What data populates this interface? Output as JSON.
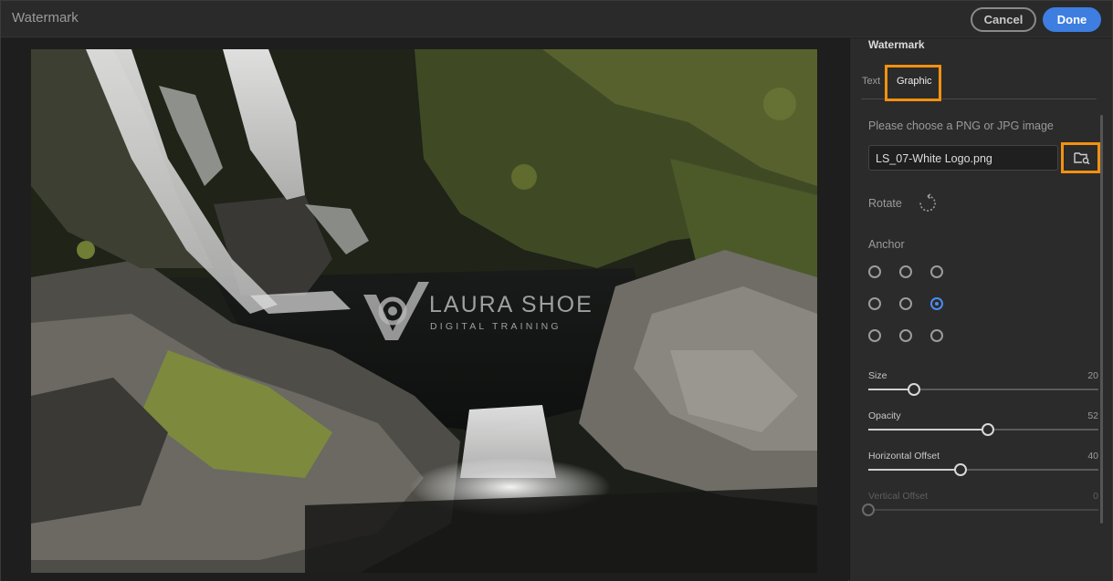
{
  "window": {
    "title": "Watermark"
  },
  "header": {
    "cancel_label": "Cancel",
    "done_label": "Done"
  },
  "preview": {
    "watermark": {
      "name": "LAURA SHOE",
      "subtitle": "DIGITAL TRAINING"
    }
  },
  "panel": {
    "title": "Watermark",
    "tabs": [
      {
        "label": "Text",
        "selected": false
      },
      {
        "label": "Graphic",
        "selected": true
      }
    ],
    "choose_label": "Please choose a PNG or JPG image",
    "file_name": "LS_07-White Logo.png",
    "rotate_label": "Rotate",
    "anchor_label": "Anchor",
    "anchor_selected": "middle-right",
    "sliders": [
      {
        "label": "Size",
        "value": "20",
        "fraction": 0.2,
        "disabled": false
      },
      {
        "label": "Opacity",
        "value": "52",
        "fraction": 0.52,
        "disabled": false
      },
      {
        "label": "Horizontal Offset",
        "value": "40",
        "fraction": 0.4,
        "disabled": false
      },
      {
        "label": "Vertical Offset",
        "value": "0",
        "fraction": 0.0,
        "disabled": true
      }
    ]
  },
  "colors": {
    "accent": "#3d7ee0",
    "highlight": "#f29111",
    "panel_bg": "#2b2b2b"
  },
  "icons": {
    "browse": "folder-search-icon",
    "rotate": "rotate-icon"
  }
}
